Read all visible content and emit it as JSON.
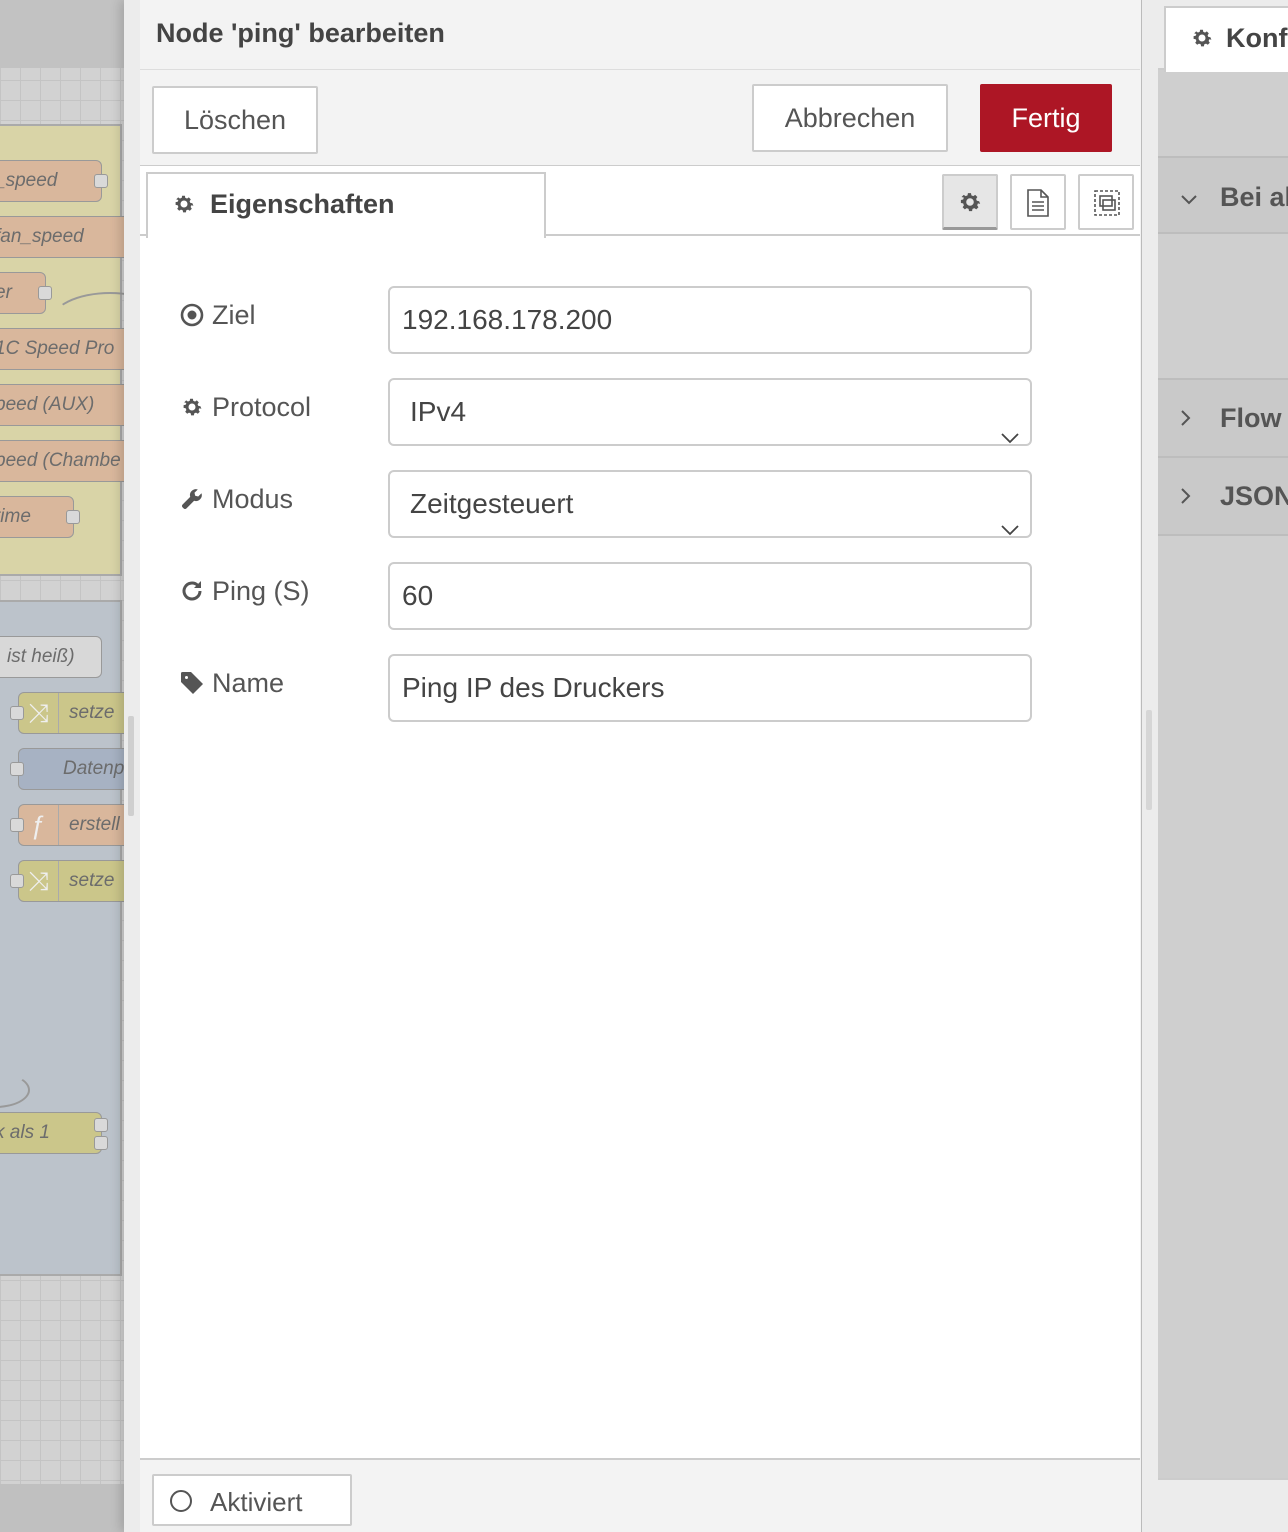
{
  "workspace": {
    "nodes": [
      {
        "label": "_speed"
      },
      {
        "label": "fan_speed"
      },
      {
        "label": "er"
      },
      {
        "label": "1C Speed Pro"
      },
      {
        "label": "peed (AUX)"
      },
      {
        "label": "peed (Chambe"
      },
      {
        "label": "time"
      },
      {
        "label": "ist heiß)"
      },
      {
        "label": "setze"
      },
      {
        "label": "Datenp"
      },
      {
        "label": "erstell"
      },
      {
        "label": "setze"
      },
      {
        "label": "k als 1"
      }
    ]
  },
  "editor": {
    "title": "Node 'ping' bearbeiten",
    "delete_label": "Löschen",
    "cancel_label": "Abbrechen",
    "done_label": "Fertig",
    "tab_properties": "Eigenschaften",
    "fields": {
      "target": {
        "label": "Ziel",
        "value": "192.168.178.200",
        "icon": "dot-circle-icon"
      },
      "protocol": {
        "label": "Protocol",
        "value": "IPv4",
        "icon": "gear-icon"
      },
      "mode": {
        "label": "Modus",
        "value": "Zeitgesteuert",
        "icon": "wrench-icon"
      },
      "ping": {
        "label": "Ping (S)",
        "value": "60",
        "icon": "refresh-icon"
      },
      "name": {
        "label": "Name",
        "value": "Ping IP des Druckers",
        "icon": "tag-icon"
      }
    },
    "footer": {
      "enabled_label": "Aktiviert"
    }
  },
  "sidebar": {
    "tab_label": "Konf",
    "sections": [
      "Bei al",
      "Flow",
      "JSON"
    ]
  },
  "colors": {
    "primary_button": "#ad1625",
    "workspace_group_yellow": "#d9d4a7",
    "workspace_group_blue": "#bcc3cb"
  }
}
